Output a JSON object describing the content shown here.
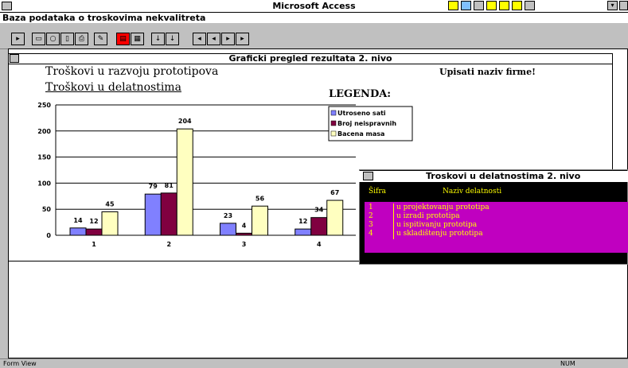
{
  "app": {
    "title": "Microsoft Access"
  },
  "database": {
    "title": "Baza podataka o troskovima nekvalitreta"
  },
  "graph_window": {
    "title": "Graficki pregled rezultata 2. nivo",
    "heading1": "Troškovi u razvoju prototipova",
    "heading2": "Troškovi u delatnostima",
    "company_note": "Upisati naziv firme!",
    "legend_title": "LEGENDA:"
  },
  "chart_data": {
    "type": "bar",
    "categories": [
      "1",
      "2",
      "3",
      "4"
    ],
    "series": [
      {
        "name": "Utroseno sati",
        "values": [
          14,
          79,
          23,
          12
        ],
        "color": "#8080ff"
      },
      {
        "name": "Broj neispravnih",
        "values": [
          12,
          81,
          4,
          34
        ],
        "color": "#800040"
      },
      {
        "name": "Bacena masa",
        "values": [
          45,
          204,
          56,
          67
        ],
        "color": "#ffffc0"
      }
    ],
    "value_labels": [
      [
        "14",
        "79",
        "23",
        "12"
      ],
      [
        "12",
        "81",
        "4",
        "34"
      ],
      [
        "45",
        "204",
        "56",
        "67"
      ]
    ],
    "yticks": [
      "0",
      "50",
      "100",
      "150",
      "200",
      "250"
    ],
    "ylim": [
      0,
      250
    ],
    "grid": true,
    "legend_position": "top-right"
  },
  "activities_window": {
    "title": "Troskovi u delatnostima 2. nivo",
    "col_code": "Šifra",
    "col_name": "Naziv delatnosti",
    "rows": [
      {
        "code": "1",
        "name": "u projektovanju prototipa"
      },
      {
        "code": "2",
        "name": "u izradi prototipa"
      },
      {
        "code": "3",
        "name": "u ispitivanju prototipa"
      },
      {
        "code": "4",
        "name": "u skladištenju prototipa"
      }
    ]
  },
  "status": {
    "mode": "Form View",
    "num": "NUM"
  },
  "colors": {
    "accent_magenta": "#c000c0",
    "text_yellow": "#ffff00"
  }
}
